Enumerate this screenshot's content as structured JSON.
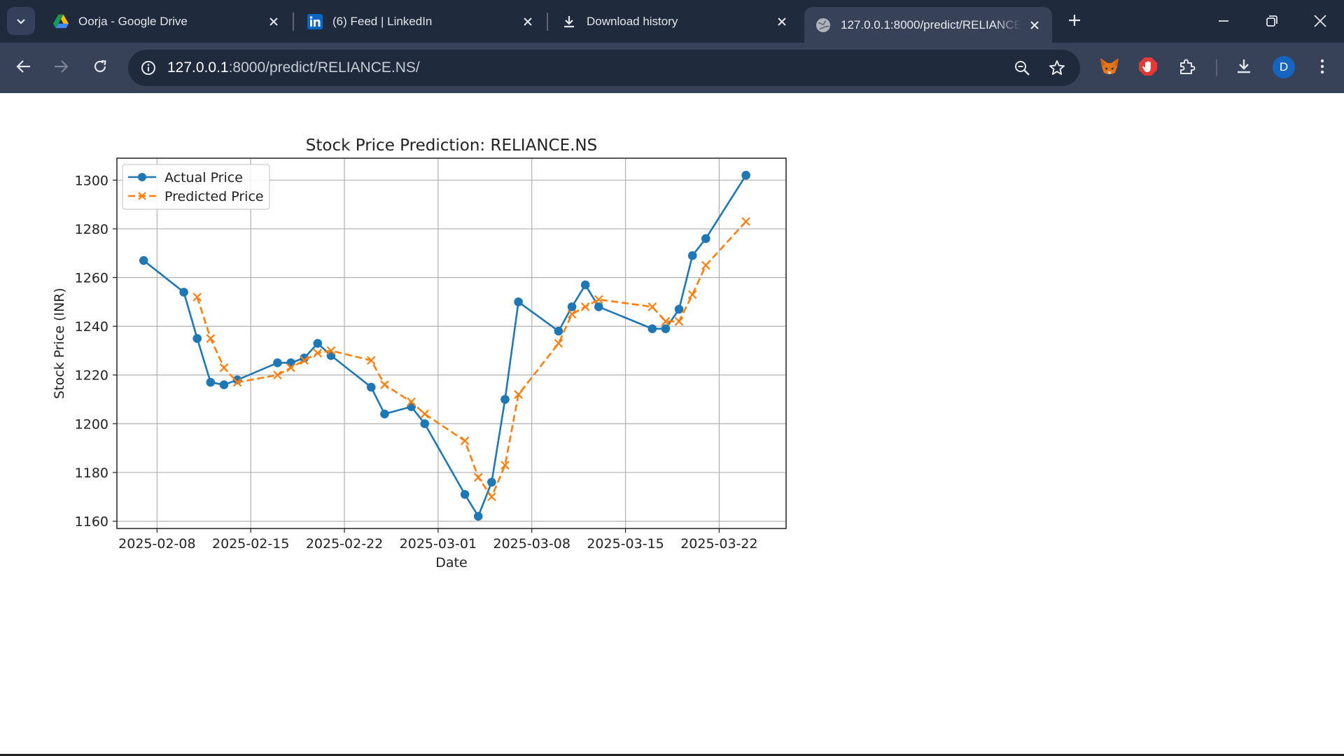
{
  "browser": {
    "tabs": [
      {
        "title": "Oorja - Google Drive",
        "icon": "google-drive-icon",
        "active": false
      },
      {
        "title": "(6) Feed | LinkedIn",
        "icon": "linkedin-icon",
        "active": false
      },
      {
        "title": "Download history",
        "icon": "download-icon",
        "active": false
      },
      {
        "title": "127.0.0.1:8000/predict/RELIANCE.NS/",
        "icon": "globe-icon",
        "active": true
      }
    ],
    "address": {
      "host": "127.0.0.1",
      "path": ":8000/predict/RELIANCE.NS/"
    },
    "profile_initial": "D",
    "colors": {
      "tabstrip": "#1f2a3d",
      "toolbar": "#374258",
      "avatar": "#1565c0"
    }
  },
  "chart_data": {
    "type": "line",
    "title": "Stock Price Prediction: RELIANCE.NS",
    "xlabel": "Date",
    "ylabel": "Stock Price (INR)",
    "x_ticks": [
      "2025-02-08",
      "2025-02-15",
      "2025-02-22",
      "2025-03-01",
      "2025-03-08",
      "2025-03-15",
      "2025-03-22"
    ],
    "y_ticks": [
      1160,
      1180,
      1200,
      1220,
      1240,
      1260,
      1280,
      1300
    ],
    "xlim": [
      "2025-02-05",
      "2025-03-27"
    ],
    "ylim": [
      1157,
      1309
    ],
    "grid": true,
    "legend_position": "top-left",
    "series": [
      {
        "name": "Actual Price",
        "color": "#1f77b4",
        "style": "solid",
        "marker": "circle",
        "points": [
          [
            "2025-02-07",
            1267
          ],
          [
            "2025-02-10",
            1254
          ],
          [
            "2025-02-11",
            1235
          ],
          [
            "2025-02-12",
            1217
          ],
          [
            "2025-02-13",
            1216
          ],
          [
            "2025-02-14",
            1218
          ],
          [
            "2025-02-17",
            1225
          ],
          [
            "2025-02-18",
            1225
          ],
          [
            "2025-02-19",
            1227
          ],
          [
            "2025-02-20",
            1233
          ],
          [
            "2025-02-21",
            1228
          ],
          [
            "2025-02-24",
            1215
          ],
          [
            "2025-02-25",
            1204
          ],
          [
            "2025-02-27",
            1207
          ],
          [
            "2025-02-28",
            1200
          ],
          [
            "2025-03-03",
            1171
          ],
          [
            "2025-03-04",
            1162
          ],
          [
            "2025-03-05",
            1176
          ],
          [
            "2025-03-06",
            1210
          ],
          [
            "2025-03-07",
            1250
          ],
          [
            "2025-03-10",
            1238
          ],
          [
            "2025-03-11",
            1248
          ],
          [
            "2025-03-12",
            1257
          ],
          [
            "2025-03-13",
            1248
          ],
          [
            "2025-03-17",
            1239
          ],
          [
            "2025-03-18",
            1239
          ],
          [
            "2025-03-19",
            1247
          ],
          [
            "2025-03-20",
            1269
          ],
          [
            "2025-03-21",
            1276
          ],
          [
            "2025-03-24",
            1302
          ]
        ]
      },
      {
        "name": "Predicted Price",
        "color": "#ff7f0e",
        "style": "dashed",
        "marker": "x",
        "points": [
          [
            "2025-02-11",
            1252
          ],
          [
            "2025-02-12",
            1235
          ],
          [
            "2025-02-13",
            1223
          ],
          [
            "2025-02-14",
            1217
          ],
          [
            "2025-02-17",
            1220
          ],
          [
            "2025-02-18",
            1223
          ],
          [
            "2025-02-19",
            1226
          ],
          [
            "2025-02-20",
            1229
          ],
          [
            "2025-02-21",
            1230
          ],
          [
            "2025-02-24",
            1226
          ],
          [
            "2025-02-25",
            1216
          ],
          [
            "2025-02-27",
            1209
          ],
          [
            "2025-02-28",
            1204
          ],
          [
            "2025-03-03",
            1193
          ],
          [
            "2025-03-04",
            1178
          ],
          [
            "2025-03-05",
            1170
          ],
          [
            "2025-03-06",
            1183
          ],
          [
            "2025-03-07",
            1212
          ],
          [
            "2025-03-10",
            1233
          ],
          [
            "2025-03-11",
            1245
          ],
          [
            "2025-03-12",
            1248
          ],
          [
            "2025-03-13",
            1251
          ],
          [
            "2025-03-17",
            1248
          ],
          [
            "2025-03-18",
            1242
          ],
          [
            "2025-03-19",
            1242
          ],
          [
            "2025-03-20",
            1253
          ],
          [
            "2025-03-21",
            1265
          ],
          [
            "2025-03-24",
            1283
          ]
        ]
      }
    ]
  }
}
